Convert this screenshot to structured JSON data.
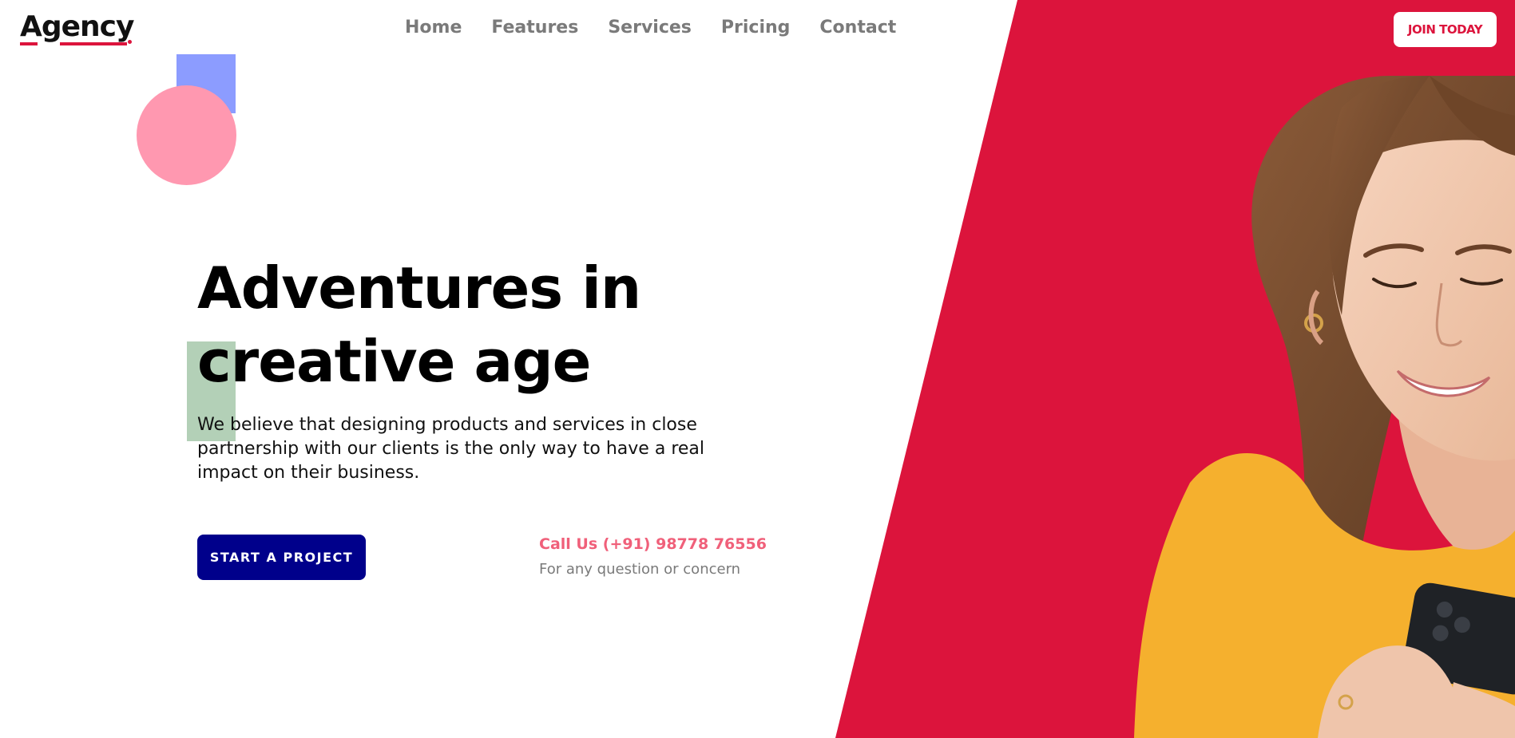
{
  "brand": {
    "logo_text": "Agency",
    "accent_color": "#dc143c"
  },
  "nav": {
    "items": [
      "Home",
      "Features",
      "Services",
      "Pricing",
      "Contact"
    ]
  },
  "header": {
    "join_label": "JOIN TODAY"
  },
  "hero": {
    "title_line1": "Adventures in",
    "title_line2": "creative age",
    "description": "We believe that designing products and services in close partnership with our clients is the only way to have a real impact on their business.",
    "cta_label": "START A PROJECT",
    "cta_color": "#00008b",
    "call_label": "Call Us (+91) 98778 76556",
    "call_subtext": "For any question or concern"
  },
  "decor": {
    "square_color": "#8c9cff",
    "circle_color": "#ff98b0",
    "rect_color": "#b3d0b7"
  }
}
